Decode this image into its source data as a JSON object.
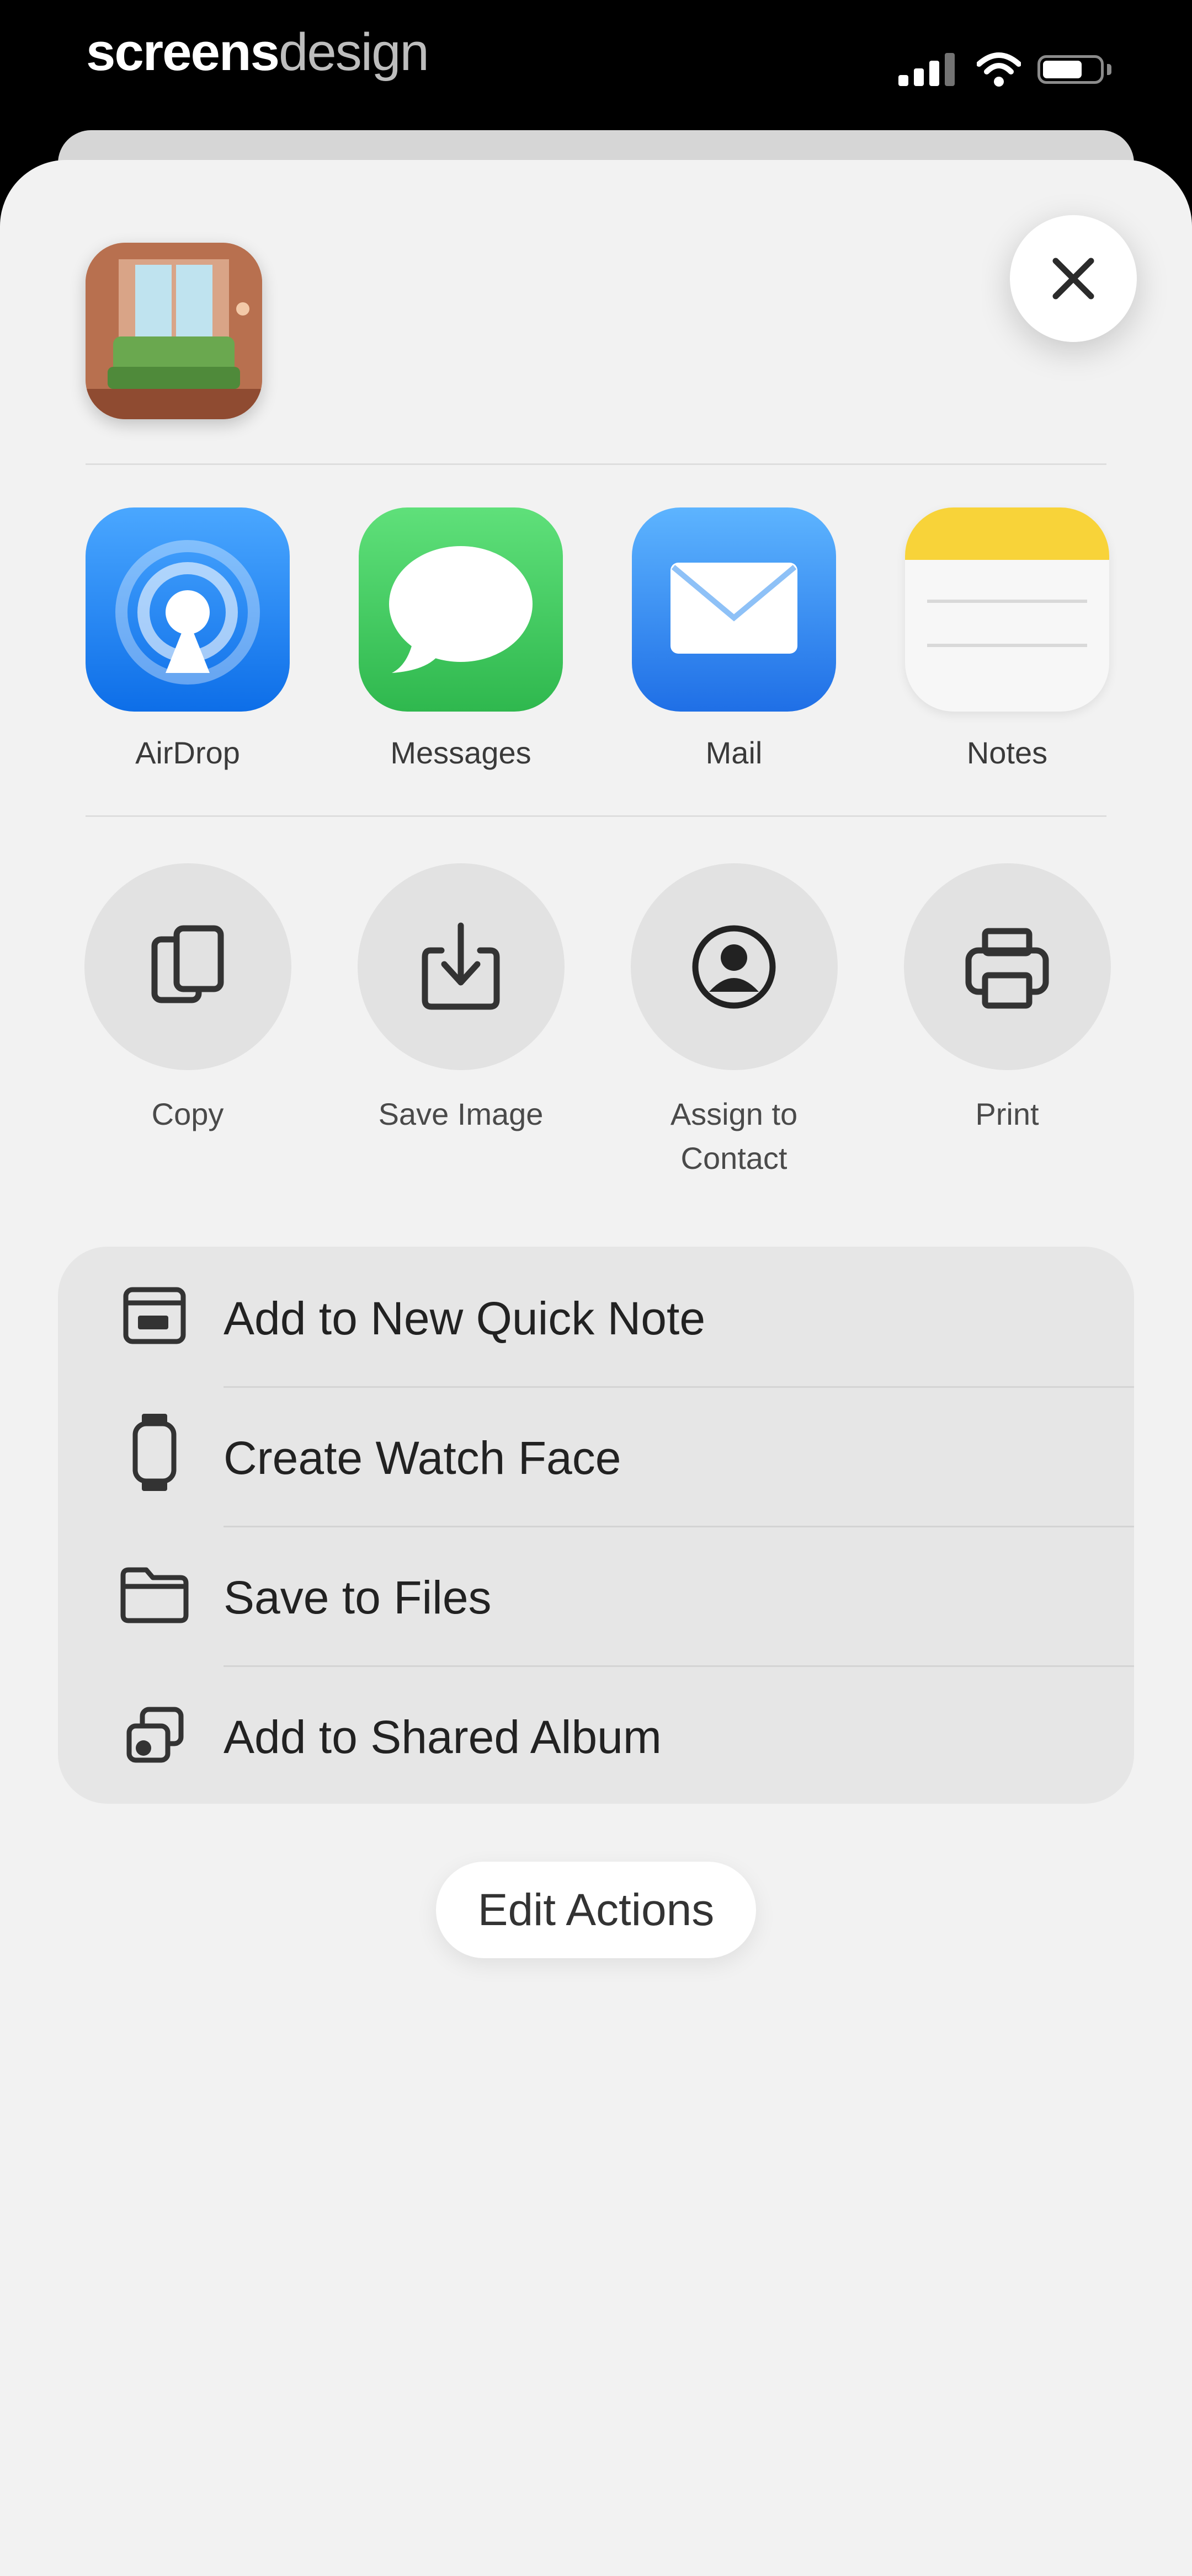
{
  "status_bar": {
    "brand_bold": "screens",
    "brand_light": "design"
  },
  "share_apps": [
    {
      "label": "AirDrop",
      "icon": "airdrop-icon"
    },
    {
      "label": "Messages",
      "icon": "messages-icon"
    },
    {
      "label": "Mail",
      "icon": "mail-icon"
    },
    {
      "label": "Notes",
      "icon": "notes-icon"
    }
  ],
  "actions": [
    {
      "label": "Copy",
      "icon": "copy-icon"
    },
    {
      "label": "Save Image",
      "icon": "save-image-icon"
    },
    {
      "label": "Assign to Contact",
      "icon": "contact-icon"
    },
    {
      "label": "Print",
      "icon": "printer-icon"
    }
  ],
  "list_actions": [
    {
      "label": "Add to New Quick Note",
      "icon": "quick-note-icon"
    },
    {
      "label": "Create Watch Face",
      "icon": "watch-icon"
    },
    {
      "label": "Save to Files",
      "icon": "folder-icon"
    },
    {
      "label": "Add to Shared Album",
      "icon": "shared-album-icon"
    }
  ],
  "edit_actions_label": "Edit Actions",
  "colors": {
    "airdrop": "#1e7cf2",
    "messages": "#34c759",
    "mail": "#2f8cf6",
    "notes_yellow": "#f8d339",
    "sheet": "#f2f2f2"
  }
}
